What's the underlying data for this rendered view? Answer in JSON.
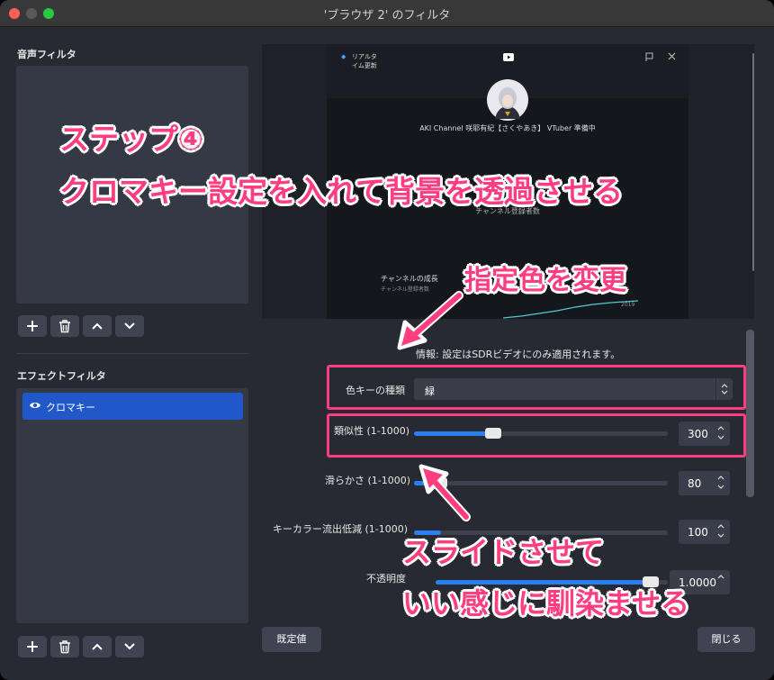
{
  "window": {
    "title": "'ブラウザ 2' のフィルタ"
  },
  "left": {
    "audio_filters_label": "音声フィルタ",
    "effect_filters_label": "エフェクトフィルタ",
    "effect_filters": [
      {
        "name": "クロマキー",
        "visible": true,
        "selected": true
      }
    ]
  },
  "preview": {
    "live_label": "リアルタイム更新",
    "channel_name": "AKI Channel 咲耶有紀【さくやあき】 VTuber 準備中",
    "subscribers_label": "チャンネル登録者数",
    "growth_label": "チャンネルの成長",
    "growth_sub": "チャンネル登録者数",
    "chart_tick": "2019"
  },
  "annotations": {
    "step": "ステップ④",
    "step_desc": "クロマキー設定を入れて背景を透過させる",
    "color_note": "指定色を変更",
    "slide_note_1": "スライドさせて",
    "slide_note_2": "いい感じに馴染ませる"
  },
  "props": {
    "info": "情報: 設定はSDRビデオにのみ適用されます。",
    "key_color_type_label": "色キーの種類",
    "key_color_type_value": "緑",
    "similarity_label": "類似性 (1-1000)",
    "similarity_value": "300",
    "smoothness_label": "滑らかさ (1-1000)",
    "smoothness_value": "80",
    "spill_label": "キーカラー流出低減 (1-1000)",
    "spill_value": "100",
    "opacity_label": "不透明度",
    "opacity_value": "1.0000",
    "similarity_level": 300,
    "smoothness_level": 80,
    "spill_level": 100,
    "opacity_level": 1.0
  },
  "buttons": {
    "defaults": "既定値",
    "close": "閉じる"
  },
  "colors": {
    "accent": "#2a7ff2",
    "highlight": "#ff3d7f",
    "selected": "#2158c9"
  }
}
